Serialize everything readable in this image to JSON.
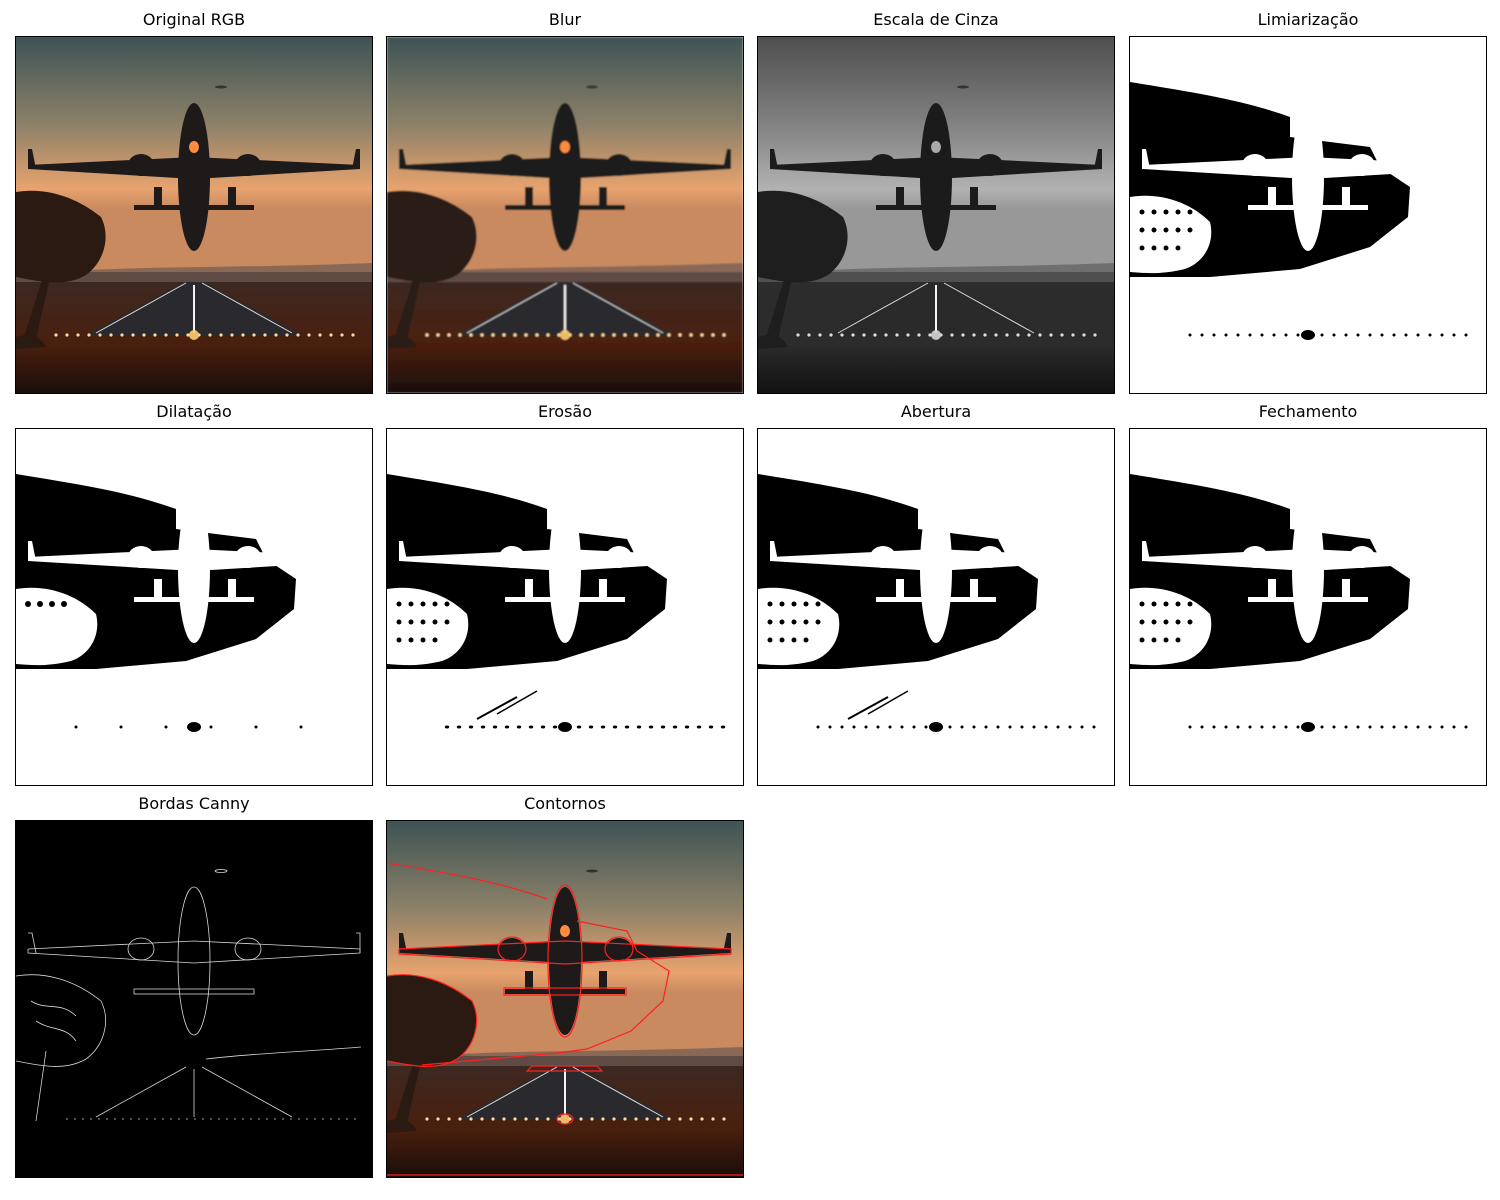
{
  "panels": [
    {
      "title": "Original RGB",
      "variant": "rgb"
    },
    {
      "title": "Blur",
      "variant": "blur"
    },
    {
      "title": "Escala de Cinza",
      "variant": "gray"
    },
    {
      "title": "Limiarização",
      "variant": "thresh"
    },
    {
      "title": "Dilatação",
      "variant": "dilate"
    },
    {
      "title": "Erosão",
      "variant": "erode"
    },
    {
      "title": "Abertura",
      "variant": "open"
    },
    {
      "title": "Fechamento",
      "variant": "close"
    },
    {
      "title": "Bordas Canny",
      "variant": "canny"
    },
    {
      "title": "Contornos",
      "variant": "contours"
    }
  ],
  "colors": {
    "sky_top": "#3e5355",
    "sky_mid": "#b99a7c",
    "horizon": "#e8a36e",
    "ground": "#4a1f0e",
    "contour": "#ff2020"
  }
}
